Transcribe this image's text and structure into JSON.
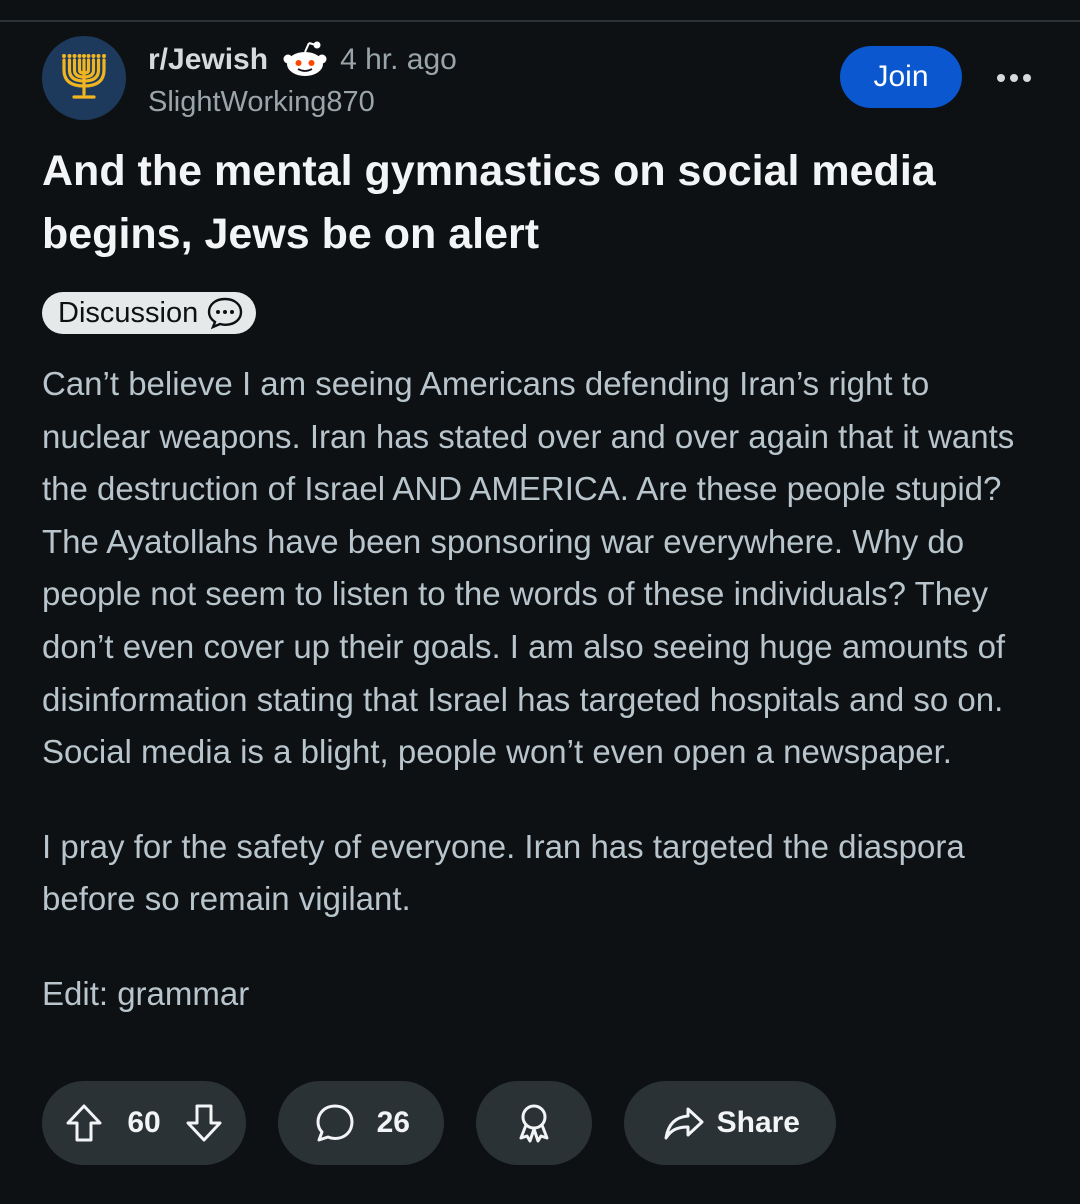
{
  "header": {
    "subreddit": "r/Jewish",
    "time": "4 hr. ago",
    "username": "SlightWorking870",
    "join_label": "Join",
    "avatar_icon": "menorah-icon",
    "colors": {
      "join": "#0a57d0",
      "avatar_bg": "#1d3a5c",
      "menorah": "#f0b521"
    }
  },
  "post": {
    "title": "And the mental gymnastics on social media begins, Jews be on alert",
    "flair": "Discussion",
    "body": [
      "Can’t believe I am seeing Americans defending Iran’s right to nuclear weapons. Iran has stated over and over again that it wants the destruction of Israel AND AMERICA. Are these people stupid? The Ayatollahs have been sponsoring war everywhere. Why do people not seem to listen to the words of these individuals? They don’t even cover up their goals. I am also seeing huge amounts of disinformation stating that Israel has targeted hospitals and so on. Social media is a blight, people won’t even open a newspaper.",
      "I pray for the safety of everyone. Iran has targeted the diaspora before so remain vigilant.",
      "Edit: grammar"
    ]
  },
  "actions": {
    "votes": "60",
    "comments": "26",
    "share_label": "Share"
  }
}
